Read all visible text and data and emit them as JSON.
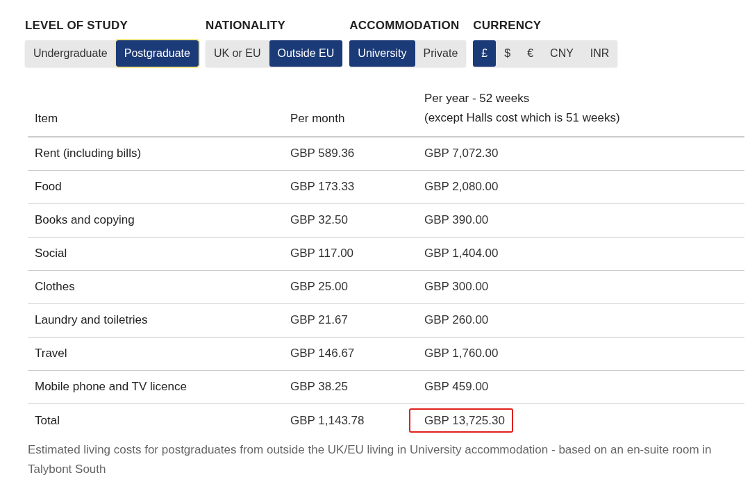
{
  "filters": [
    {
      "label": "LEVEL OF STUDY",
      "options": [
        {
          "label": "Undergraduate",
          "selected": false,
          "focused": false
        },
        {
          "label": "Postgraduate",
          "selected": true,
          "focused": true
        }
      ]
    },
    {
      "label": "NATIONALITY",
      "options": [
        {
          "label": "UK or EU",
          "selected": false,
          "focused": false
        },
        {
          "label": "Outside EU",
          "selected": true,
          "focused": false
        }
      ]
    },
    {
      "label": "ACCOMMODATION",
      "options": [
        {
          "label": "University",
          "selected": true,
          "focused": false
        },
        {
          "label": "Private",
          "selected": false,
          "focused": false
        }
      ]
    },
    {
      "label": "CURRENCY",
      "options": [
        {
          "label": "£",
          "selected": true,
          "focused": false
        },
        {
          "label": "$",
          "selected": false,
          "focused": false
        },
        {
          "label": "€",
          "selected": false,
          "focused": false
        },
        {
          "label": "CNY",
          "selected": false,
          "focused": false
        },
        {
          "label": "INR",
          "selected": false,
          "focused": false
        }
      ]
    }
  ],
  "table": {
    "columns": [
      "Item",
      "Per month",
      [
        "Per year - 52 weeks",
        "(except Halls cost which is 51 weeks)"
      ]
    ],
    "rows": [
      {
        "item": "Rent (including bills)",
        "per_month": "GBP 589.36",
        "per_year": "GBP 7,072.30",
        "highlighted": false
      },
      {
        "item": "Food",
        "per_month": "GBP 173.33",
        "per_year": "GBP 2,080.00",
        "highlighted": false
      },
      {
        "item": "Books and copying",
        "per_month": "GBP 32.50",
        "per_year": "GBP 390.00",
        "highlighted": false
      },
      {
        "item": "Social",
        "per_month": "GBP 117.00",
        "per_year": "GBP 1,404.00",
        "highlighted": false
      },
      {
        "item": "Clothes",
        "per_month": "GBP 25.00",
        "per_year": "GBP 300.00",
        "highlighted": false
      },
      {
        "item": "Laundry and toiletries",
        "per_month": "GBP 21.67",
        "per_year": "GBP 260.00",
        "highlighted": false
      },
      {
        "item": "Travel",
        "per_month": "GBP 146.67",
        "per_year": "GBP 1,760.00",
        "highlighted": false
      },
      {
        "item": "Mobile phone and TV licence",
        "per_month": "GBP 38.25",
        "per_year": "GBP 459.00",
        "highlighted": false
      },
      {
        "item": "Total",
        "per_month": "GBP 1,143.78",
        "per_year": "GBP 13,725.30",
        "highlighted": true
      }
    ]
  },
  "caption": "Estimated living costs for postgraduates from outside the UK/EU living in University accommodation - based on an en-suite room in Talybont South"
}
